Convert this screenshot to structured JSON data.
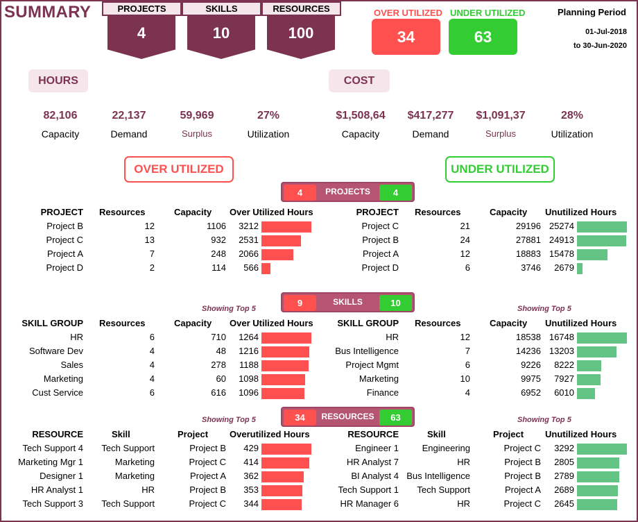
{
  "header": {
    "title": "SUMMARY",
    "kpis": [
      {
        "label": "PROJECTS",
        "value": "4"
      },
      {
        "label": "SKILLS",
        "value": "10"
      },
      {
        "label": "RESOURCES",
        "value": "100"
      }
    ],
    "over_utilized": {
      "label": "OVER UTILIZED",
      "value": "34"
    },
    "under_utilized": {
      "label": "UNDER UTILIZED",
      "value": "63"
    },
    "planning_period": {
      "title": "Planning Period",
      "from": "01-Jul-2018",
      "to": "to 30-Jun-2020"
    }
  },
  "hours": {
    "label": "HOURS",
    "metrics": [
      {
        "value": "82,106",
        "label": "Capacity"
      },
      {
        "value": "22,137",
        "label": "Demand"
      },
      {
        "value": "59,969",
        "label": "Surplus"
      },
      {
        "value": "27%",
        "label": "Utilization"
      }
    ]
  },
  "cost": {
    "label": "COST",
    "metrics": [
      {
        "value": "$1,508,64",
        "label": "Capacity"
      },
      {
        "value": "$417,277",
        "label": "Demand"
      },
      {
        "value": "$1,091,37",
        "label": "Surplus"
      },
      {
        "value": "28%",
        "label": "Utilization"
      }
    ]
  },
  "panels": {
    "over_label": "OVER UTILIZED",
    "under_label": "UNDER UTILIZED",
    "showing_top": "Showing Top 5"
  },
  "colors": {
    "over": "#ff5050",
    "under": "#33cc33",
    "under_bar": "#63c384",
    "brand": "#7b3350"
  },
  "projects": {
    "badge": {
      "over": "4",
      "label": "PROJECTS",
      "under": "4"
    },
    "over": {
      "headers": [
        "PROJECT",
        "Resources",
        "Capacity",
        "Over Utilized Hours"
      ],
      "max": 3212,
      "rows": [
        {
          "name": "Project B",
          "resources": "12",
          "capacity": "1106",
          "hours": 3212
        },
        {
          "name": "Project C",
          "resources": "13",
          "capacity": "932",
          "hours": 2531
        },
        {
          "name": "Project A",
          "resources": "7",
          "capacity": "248",
          "hours": 2066
        },
        {
          "name": "Project D",
          "resources": "2",
          "capacity": "114",
          "hours": 566
        }
      ]
    },
    "under": {
      "headers": [
        "PROJECT",
        "Resources",
        "Capacity",
        "Unutilized Hours"
      ],
      "max": 25274,
      "rows": [
        {
          "name": "Project C",
          "resources": "21",
          "capacity": "29196",
          "hours": 25274
        },
        {
          "name": "Project B",
          "resources": "24",
          "capacity": "27881",
          "hours": 24913
        },
        {
          "name": "Project A",
          "resources": "12",
          "capacity": "18883",
          "hours": 15478
        },
        {
          "name": "Project D",
          "resources": "6",
          "capacity": "3746",
          "hours": 2679
        }
      ]
    }
  },
  "skills": {
    "badge": {
      "over": "9",
      "label": "SKILLS",
      "under": "10"
    },
    "over": {
      "headers": [
        "SKILL GROUP",
        "Resources",
        "Capacity",
        "Over Utilized Hours"
      ],
      "max": 1264,
      "rows": [
        {
          "name": "HR",
          "resources": "6",
          "capacity": "710",
          "hours": 1264
        },
        {
          "name": "Software Dev",
          "resources": "4",
          "capacity": "48",
          "hours": 1216
        },
        {
          "name": "Sales",
          "resources": "4",
          "capacity": "278",
          "hours": 1188
        },
        {
          "name": "Marketing",
          "resources": "4",
          "capacity": "60",
          "hours": 1098
        },
        {
          "name": "Cust Service",
          "resources": "6",
          "capacity": "616",
          "hours": 1096
        }
      ]
    },
    "under": {
      "headers": [
        "SKILL GROUP",
        "Resources",
        "Capacity",
        "Unutilized Hours"
      ],
      "max": 16748,
      "rows": [
        {
          "name": "HR",
          "resources": "12",
          "capacity": "18538",
          "hours": 16748
        },
        {
          "name": "Bus Intelligence",
          "resources": "7",
          "capacity": "14236",
          "hours": 13203
        },
        {
          "name": "Project Mgmt",
          "resources": "6",
          "capacity": "9226",
          "hours": 8222
        },
        {
          "name": "Marketing",
          "resources": "10",
          "capacity": "9975",
          "hours": 7927
        },
        {
          "name": "Finance",
          "resources": "4",
          "capacity": "6952",
          "hours": 6010
        }
      ]
    }
  },
  "resources": {
    "badge": {
      "over": "34",
      "label": "RESOURCES",
      "under": "63"
    },
    "over": {
      "headers": [
        "RESOURCE",
        "Skill",
        "Project",
        "Overutilized Hours"
      ],
      "max": 429,
      "rows": [
        {
          "name": "Tech Support 4",
          "skill": "Tech Support",
          "project": "Project B",
          "hours": 429
        },
        {
          "name": "Marketing Mgr 1",
          "skill": "Marketing",
          "project": "Project C",
          "hours": 414
        },
        {
          "name": "Designer 1",
          "skill": "Marketing",
          "project": "Project A",
          "hours": 362
        },
        {
          "name": "HR Analyst 1",
          "skill": "HR",
          "project": "Project B",
          "hours": 353
        },
        {
          "name": "Tech Support 3",
          "skill": "Tech Support",
          "project": "Project C",
          "hours": 344
        }
      ]
    },
    "under": {
      "headers": [
        "RESOURCE",
        "Skill",
        "Project",
        "Unutilized Hours"
      ],
      "max": 3292,
      "rows": [
        {
          "name": "Engineer 1",
          "skill": "Engineering",
          "project": "Project C",
          "hours": 3292
        },
        {
          "name": "HR Analyst 7",
          "skill": "HR",
          "project": "Project B",
          "hours": 2805
        },
        {
          "name": "BI Analyst 4",
          "skill": "Bus Intelligence",
          "project": "Project B",
          "hours": 2789
        },
        {
          "name": "Tech Support 1",
          "skill": "Tech Support",
          "project": "Project A",
          "hours": 2689
        },
        {
          "name": "HR Manager 6",
          "skill": "HR",
          "project": "Project C",
          "hours": 2645
        }
      ]
    }
  }
}
